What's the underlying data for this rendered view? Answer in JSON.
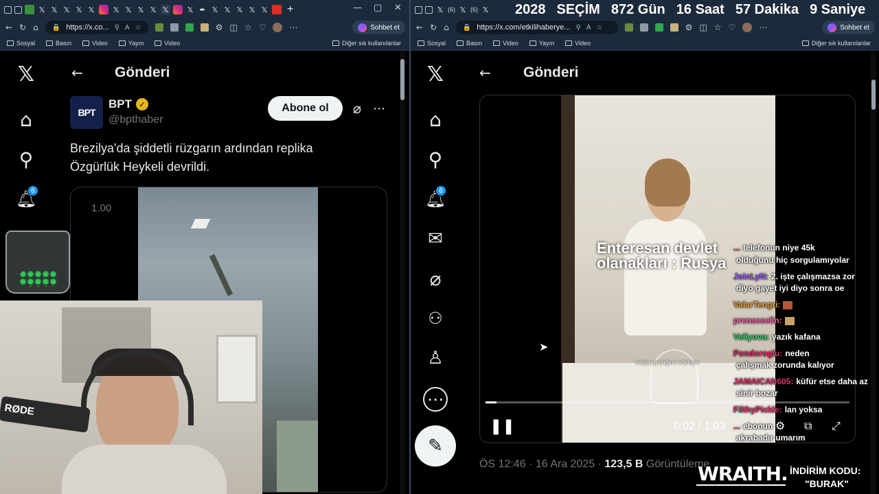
{
  "left_window": {
    "address": "https://x.co...",
    "bookmarks": [
      "Sosyal",
      "Basın",
      "Video",
      "Yayın",
      "Video"
    ],
    "bookmark_other": "Diğer sık kullanılanlar",
    "copilot": "Sohbet et",
    "header_title": "Gönderi",
    "notif_count": "6",
    "post": {
      "avatar_text": "BPT",
      "name": "BPT",
      "handle": "@bpthaber",
      "follow": "Abone ol",
      "text_line1": "Brezilya'da şiddetli rüzgarın ardından replika",
      "text_line2": "Özgürlük Heykeli devrildi.",
      "video_label": "1.00"
    },
    "overlay_brand": "RØDE"
  },
  "right_window": {
    "address": "https://x.com/etkilihaberye...",
    "bookmarks": [
      "Sosyal",
      "Basın",
      "Video",
      "Yayın",
      "Video"
    ],
    "bookmark_other": "Diğer sık kullanılanlar",
    "copilot": "Sohbet et",
    "header_title": "Gönderi",
    "notif_count": "6",
    "tab_counts": [
      "(6)",
      "(6)"
    ],
    "video": {
      "caption_line1": "Enteresan devlet",
      "caption_line2": "olanakları : Rusya",
      "subtitle": "dalga geçtiğimi söylüyo",
      "time": "0:02 / 1:03",
      "progress": 0.03
    },
    "meta": {
      "time": "ÖS 12:46",
      "date": "16 Ara 2025",
      "views": "123,5 B",
      "views_label": "Görüntüleme"
    }
  },
  "countdown": {
    "year": "2028",
    "election": "SEÇİM",
    "days": "872 Gün",
    "hours": "16 Saat",
    "minutes": "57 Dakika",
    "seconds": "9 Saniye"
  },
  "chat": [
    {
      "name": "...",
      "text": "telefonun niye 45k",
      "color": "#e0306a"
    },
    {
      "name": "",
      "text": "olduğunu hiç sorgulamıyolar",
      "color": "#ffffff"
    },
    {
      "name": "JoinLyN:",
      "text": "2. işte çalışmazsa zor",
      "color": "#9b59ff"
    },
    {
      "name": "",
      "text": "diyo gayet iyi diyo sonra oe",
      "color": "#ffffff"
    },
    {
      "name": "ValarTengri:",
      "text": "",
      "color": "#e8a33a"
    },
    {
      "name": "prenseselin:",
      "text": "",
      "color": "#ff5fb0"
    },
    {
      "name": "Veliyova:",
      "text": "yazık kafana",
      "color": "#36d36b"
    },
    {
      "name": "Pondoroglu:",
      "text": "neden",
      "color": "#e0306a"
    },
    {
      "name": "",
      "text": "çalışmak zorunda kalıyor",
      "color": "#ffffff"
    },
    {
      "name": "JAMAICAN605:",
      "text": "küfür etse daha az",
      "color": "#e0306a"
    },
    {
      "name": "",
      "text": "sinir bozar",
      "color": "#ffffff"
    },
    {
      "name": "FilthyPickle:",
      "text": "lan yoksa",
      "color": "#e0306a"
    },
    {
      "name": "...",
      "text": "ebonun",
      "color": "#e0306a"
    },
    {
      "name": "",
      "text": "akrabadır umarım",
      "color": "#ffffff"
    }
  ],
  "sponsor": {
    "brand": "WRAITH.",
    "code_label": "İNDİRİM KODU:",
    "code": "\"BURAK\""
  }
}
